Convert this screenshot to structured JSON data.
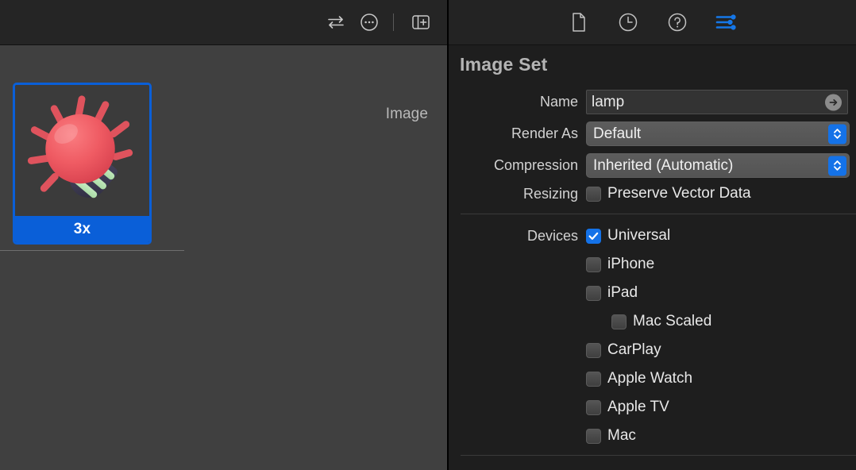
{
  "left_panel": {
    "toolbar": {
      "buttons": [
        {
          "name": "swap-arrows-icon",
          "label": "Toggle Comparison"
        },
        {
          "name": "ellipsis-circle-icon",
          "label": "More Options"
        },
        {
          "name": "add-panel-icon",
          "label": "Add Editor"
        }
      ]
    },
    "kind_label": "Image",
    "asset": {
      "caption": "3x",
      "selected": true,
      "art": "lamp-illustration"
    }
  },
  "right_panel": {
    "toolbar": {
      "buttons": [
        {
          "name": "document-icon",
          "label": "File Inspector",
          "active": false
        },
        {
          "name": "clock-icon",
          "label": "History Inspector",
          "active": false
        },
        {
          "name": "help-circle-icon",
          "label": "Quick Help Inspector",
          "active": false
        },
        {
          "name": "sliders-icon",
          "label": "Attributes Inspector",
          "active": true
        }
      ]
    },
    "title": "Image Set",
    "fields": {
      "name_label": "Name",
      "name_value": "lamp",
      "name_placeholder": "Name",
      "render_as_label": "Render As",
      "render_as_value": "Default",
      "compression_label": "Compression",
      "compression_value": "Inherited (Automatic)",
      "resizing_label": "Resizing",
      "resizing_option": "Preserve Vector Data",
      "resizing_checked": false,
      "devices_label": "Devices"
    },
    "devices": [
      {
        "label": "Universal",
        "checked": true,
        "indent": false
      },
      {
        "label": "iPhone",
        "checked": false,
        "indent": false
      },
      {
        "label": "iPad",
        "checked": false,
        "indent": false
      },
      {
        "label": "Mac Scaled",
        "checked": false,
        "indent": true
      },
      {
        "label": "CarPlay",
        "checked": false,
        "indent": false
      },
      {
        "label": "Apple Watch",
        "checked": false,
        "indent": false
      },
      {
        "label": "Apple TV",
        "checked": false,
        "indent": false
      },
      {
        "label": "Mac",
        "checked": false,
        "indent": false
      }
    ]
  },
  "colors": {
    "accent_blue": "#0a5fd8",
    "control_blue": "#1472e8",
    "left_bg": "#404040",
    "right_bg": "#1e1e1e",
    "toolbar_bg": "#232323",
    "lamp_bulb": "#ef5b63",
    "lamp_base": "#3d3b52",
    "lamp_rings": "#b8e3b4"
  }
}
